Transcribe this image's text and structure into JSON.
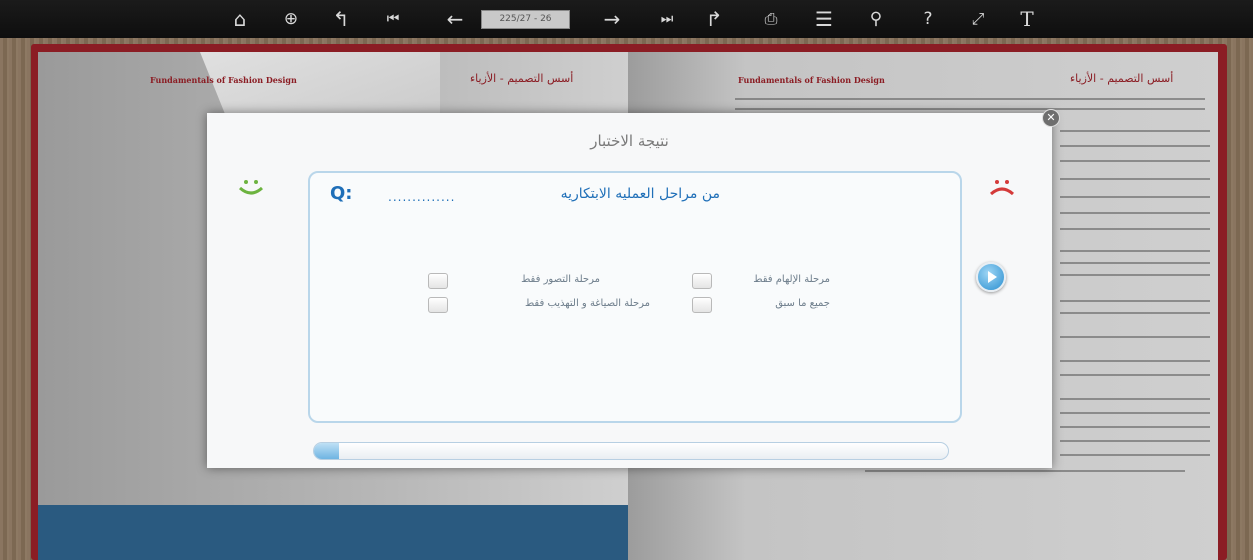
{
  "toolbar": {
    "page_box": "225/27 - 26",
    "icons": [
      "home-icon",
      "zoom-in-icon",
      "back-icon",
      "first-page-icon",
      "previous-page-icon",
      "page-input",
      "next-page-icon",
      "last-page-icon",
      "forward-icon",
      "print-icon",
      "table-of-contents-icon",
      "search-icon",
      "help-icon",
      "fullscreen-icon",
      "text-icon"
    ]
  },
  "book": {
    "left_header_en": "Fundamentals of Fashion Design",
    "left_header_ar": "أسس التصميم - الأزياء",
    "right_header_en": "Fundamentals of Fashion Design",
    "right_header_ar": "أسس التصميم - الأزياء"
  },
  "modal": {
    "title": "نتيجة الاختبار",
    "question_label": "Q:",
    "question_dots": "..............",
    "question_text": "من مراحل العمليه الابتكاريه",
    "options": [
      "مرحلة الإلهام فقط",
      "مرحلة التصور فقط",
      "جميع ما سبق",
      "مرحلة الصياغة و التهذيب فقط"
    ],
    "progress_fraction": 0.04
  },
  "colors": {
    "book_border": "#8b1d24",
    "accent_blue": "#1f6fb8",
    "smile_green": "#6cb33f",
    "sad_red": "#d43a3a"
  }
}
